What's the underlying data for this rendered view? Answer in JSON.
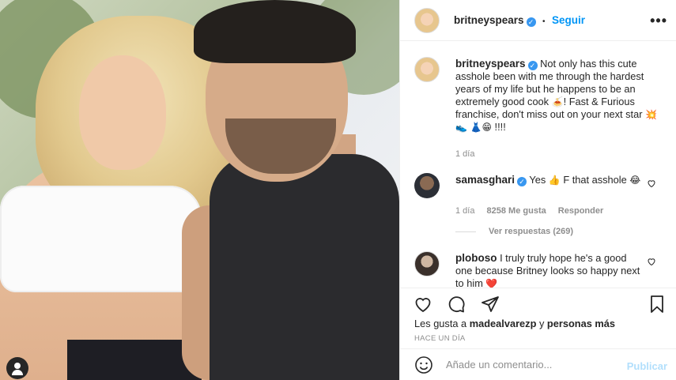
{
  "header": {
    "username": "britneyspears",
    "verified_mark": "✓",
    "separator": "•",
    "follow_label": "Seguir",
    "more_label": "•••"
  },
  "caption": {
    "username": "britneyspears",
    "text_1": "Not only has this cute asshole been with me through the hardest years of my life but he happens to be an extremely good cook",
    "emoji_1": "🍝",
    "text_2": "! Fast & Furious franchise, don't miss out on your next star",
    "emoji_2": "💥👟",
    "emoji_3": "👗😁",
    "text_3": "!!!!",
    "time": "1 día"
  },
  "comments": [
    {
      "username": "samasghari",
      "text_1": "Yes",
      "emoji_1": "👍",
      "text_2": "F that asshole",
      "emoji_2": "😂",
      "time": "1 día",
      "likes": "8258 Me gusta",
      "reply_label": "Responder",
      "view_replies": "Ver respuestas (269)"
    },
    {
      "username": "ploboso",
      "text": "I truly truly hope he's a good one because Britney looks so happy next to him",
      "emoji": "❤️"
    }
  ],
  "likes_line": {
    "prefix": "Les gusta a",
    "user": "madealvarezp",
    "middle": "y",
    "others": "personas más"
  },
  "timestamp": "HACE UN DÍA",
  "composer": {
    "placeholder": "Añade un comentario...",
    "post_label": "Publicar"
  },
  "icons": {
    "heart": "heart-icon",
    "comment": "comment-icon",
    "share": "share-icon",
    "save": "bookmark-icon",
    "emoji": "emoji-icon",
    "user_tag": "user-tag-icon"
  },
  "colors": {
    "link_blue": "#0095f6",
    "verified_blue": "#3897f0",
    "post_disabled": "#b2dffc",
    "heart_red": "#ed4956",
    "muted": "#8e8e8e"
  }
}
